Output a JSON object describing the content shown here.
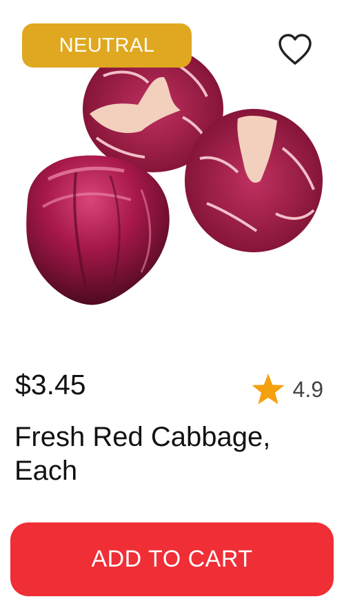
{
  "product": {
    "badge": "NEUTRAL",
    "price": "$3.45",
    "rating": "4.9",
    "name": "Fresh Red Cabbage, Each",
    "image": "red-cabbage-photo",
    "favorite_icon": "heart-outline-icon",
    "rating_icon": "star-icon"
  },
  "actions": {
    "add_to_cart": "ADD TO CART"
  },
  "colors": {
    "badge_bg": "#E0A820",
    "star": "#F5A00F",
    "button_bg": "#EF2E36",
    "cabbage_dark": "#8A1238",
    "cabbage_light": "#F2C4B8"
  }
}
